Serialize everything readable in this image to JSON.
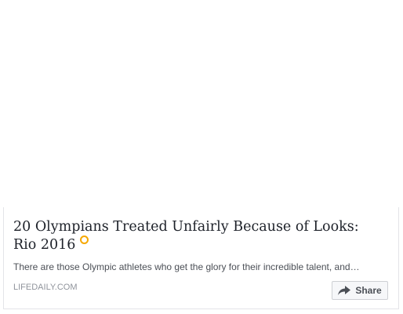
{
  "card": {
    "title": "20 Olympians Treated Unfairly Because of Looks: Rio 2016",
    "description": "There are those Olympic athletes who get the glory for their incredible talent, and…",
    "domain": "LIFEDAILY.COM",
    "share_label": "Share",
    "title_icon": "olympic-ring-icon",
    "share_icon": "share-arrow-icon",
    "accent_color": "#f6a800"
  }
}
